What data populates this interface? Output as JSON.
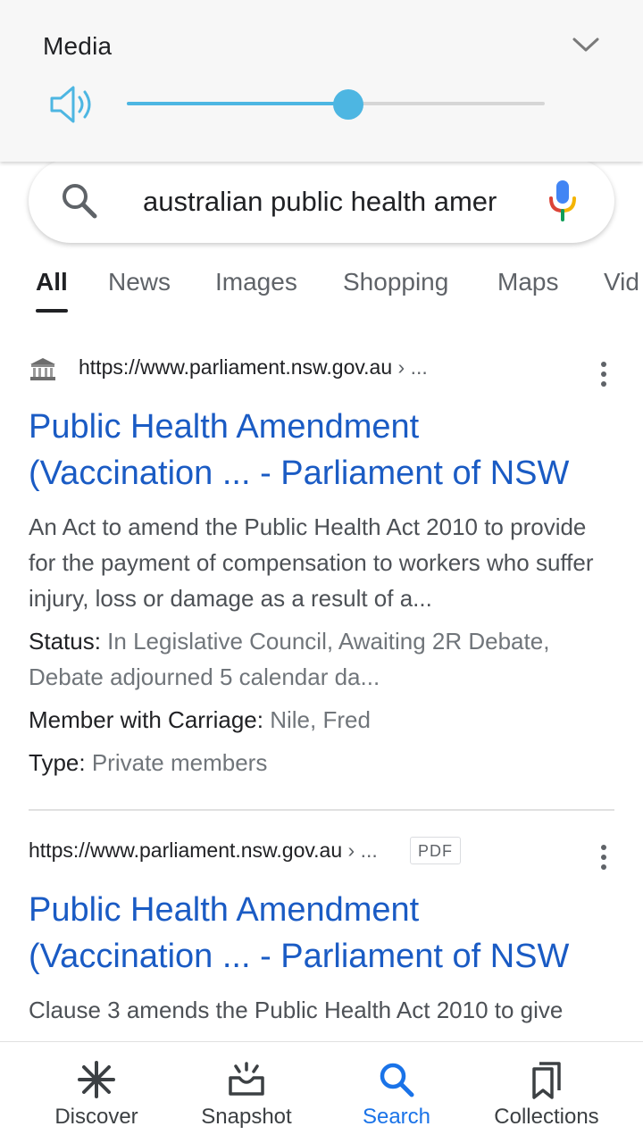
{
  "media_panel": {
    "title": "Media",
    "volume_level": 0.53,
    "accent_color": "#4db6e2",
    "icons": {
      "expand": "chevron-down-icon",
      "volume": "speaker-icon"
    }
  },
  "search": {
    "query": "australian public health amer",
    "icons": {
      "search": "search-icon",
      "mic": "mic-icon"
    }
  },
  "tabs": [
    {
      "label": "All",
      "active": true
    },
    {
      "label": "News"
    },
    {
      "label": "Images"
    },
    {
      "label": "Shopping"
    },
    {
      "label": "Maps"
    },
    {
      "label": "Vid"
    }
  ],
  "results": [
    {
      "url": "https://www.parliament.nsw.gov.au",
      "crumb": "› ...",
      "title_line1": "Public Health Amendment",
      "title_line2": "(Vaccination ... - Parliament of NSW",
      "snippet": "An Act to amend the Public Health Act 2010 to provide for the payment of compensation to workers who suffer injury, loss or damage as a result of a...",
      "fields": [
        {
          "label": "Status: ",
          "value": "In Legislative Council, Awaiting 2R Debate, Debate adjourned 5 calendar da..."
        },
        {
          "label": "Member with Carriage: ",
          "value": "Nile, Fred"
        },
        {
          "label": "Type: ",
          "value": "Private members"
        }
      ]
    },
    {
      "url": "https://www.parliament.nsw.gov.au",
      "crumb": "› ...",
      "badge": "PDF",
      "title_line1": "Public Health Amendment",
      "title_line2": "(Vaccination ... - Parliament of NSW",
      "snippet": "Clause 3 amends the Public Health Act 2010 to give"
    }
  ],
  "bottom_nav": [
    {
      "label": "Discover",
      "icon": "asterisk-icon"
    },
    {
      "label": "Snapshot",
      "icon": "snapshot-icon"
    },
    {
      "label": "Search",
      "icon": "search-icon",
      "active": true
    },
    {
      "label": "Collections",
      "icon": "bookmarks-icon"
    }
  ],
  "colors": {
    "link": "#1a5bc4",
    "active_nav": "#1a73e8",
    "snippet": "#4d5156"
  }
}
